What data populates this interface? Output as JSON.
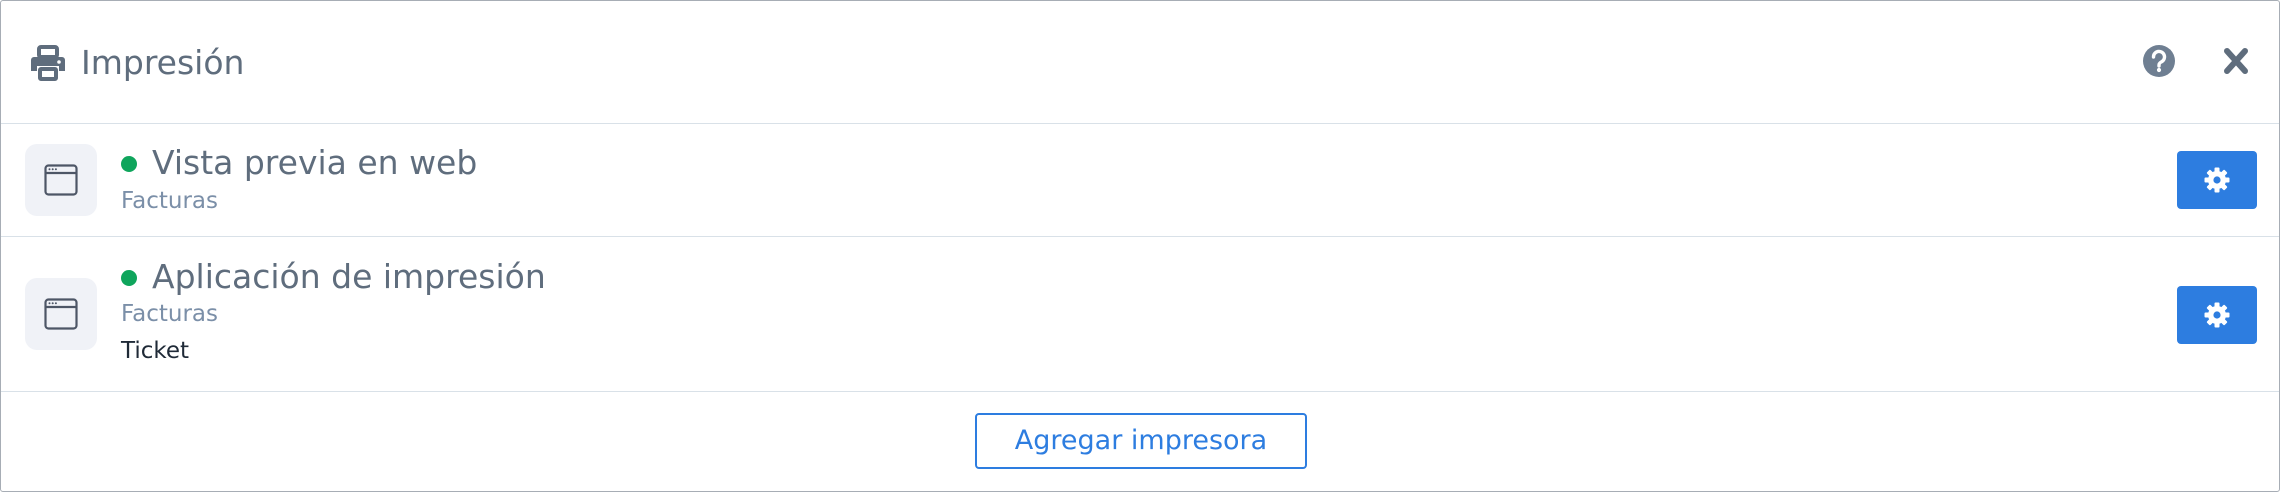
{
  "dialog": {
    "title": "Impresión",
    "header_icon": "printer-icon",
    "help_icon": "question-circle-icon",
    "close_icon": "close-icon"
  },
  "printers": [
    {
      "name": "Vista previa en web",
      "status_color": "#0fa55c",
      "icon": "browser-window-icon",
      "document_types": [
        "Facturas"
      ],
      "settings_icon": "gear-icon"
    },
    {
      "name": "Aplicación de impresión",
      "status_color": "#0fa55c",
      "icon": "browser-window-icon",
      "document_types": [
        "Facturas",
        "Ticket"
      ],
      "settings_icon": "gear-icon"
    }
  ],
  "footer": {
    "add_button_label": "Agregar impresora"
  },
  "colors": {
    "accent": "#2d7de0",
    "text_muted": "#5f6d7d",
    "status_online": "#0fa55c"
  }
}
